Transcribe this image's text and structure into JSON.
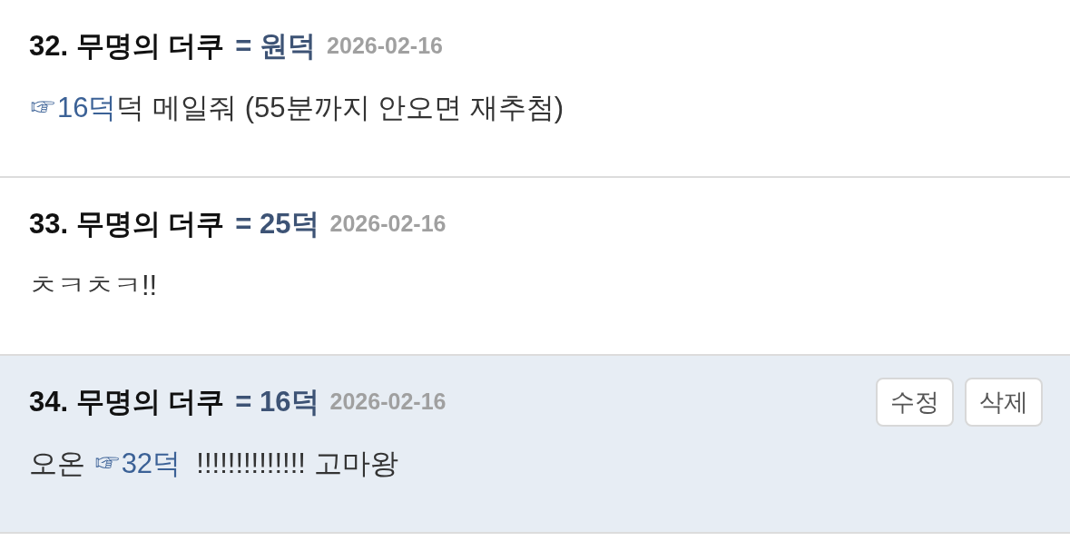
{
  "comments": [
    {
      "number": "32.",
      "author": "무명의 더쿠",
      "reply_to": "= 원덕",
      "date": "2026-02-16",
      "mine": false,
      "body": [
        {
          "kind": "link",
          "text": "☞16덕"
        },
        {
          "kind": "text",
          "text": "덕 메일줘 (55분까지 안오면 재추첨)"
        }
      ]
    },
    {
      "number": "33.",
      "author": "무명의 더쿠",
      "reply_to": "= 25덕",
      "date": "2026-02-16",
      "mine": false,
      "body": [
        {
          "kind": "text",
          "text": "ㅊㅋㅊㅋ!!"
        }
      ]
    },
    {
      "number": "34.",
      "author": "무명의 더쿠",
      "reply_to": "= 16덕",
      "date": "2026-02-16",
      "mine": true,
      "buttons": [
        "수정",
        "삭제"
      ],
      "body": [
        {
          "kind": "text",
          "text": "오온 "
        },
        {
          "kind": "link",
          "text": "☞32덕"
        },
        {
          "kind": "text",
          "text": "  !!!!!!!!!!!!!! 고마왕"
        }
      ]
    }
  ]
}
